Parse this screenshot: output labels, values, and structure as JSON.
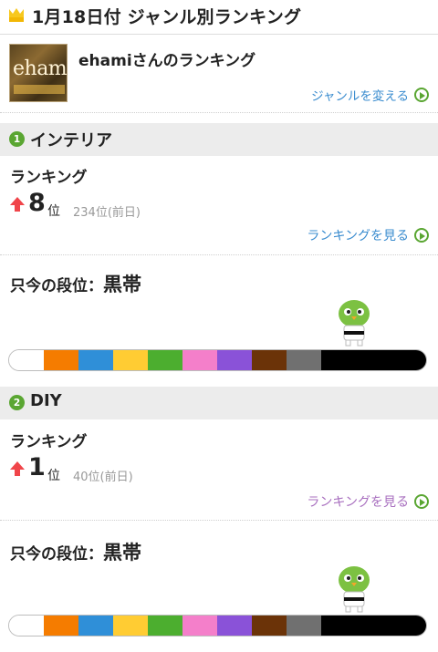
{
  "header": {
    "title": "1月18日付 ジャンル別ランキング"
  },
  "user": {
    "avatar_text": "ehami",
    "name": "ehamiさんのランキング",
    "change_genre": "ジャンルを変える"
  },
  "genres": [
    {
      "number": "1",
      "name": "インテリア",
      "ranking_label": "ランキング",
      "rank": "8",
      "rank_unit": "位",
      "previous": "234位(前日)",
      "see_ranking": "ランキングを見る",
      "see_ranking_color": "#3a8ccf",
      "dan_label": "只今の段位：",
      "dan_value": "黒帯"
    },
    {
      "number": "2",
      "name": "DIY",
      "ranking_label": "ランキング",
      "rank": "1",
      "rank_unit": "位",
      "previous": "40位(前日)",
      "see_ranking": "ランキングを見る",
      "see_ranking_color": "#a86fbf",
      "dan_label": "只今の段位：",
      "dan_value": "黒帯"
    }
  ],
  "belt_colors": [
    "#ffffff",
    "#f57c00",
    "#2f8fd8",
    "#ffcc33",
    "#4cae2f",
    "#f47fca",
    "#8a52d8",
    "#6b3308",
    "#707070",
    "#000000"
  ],
  "icons": {
    "crown": "crown-icon",
    "arrow": "up-arrow-icon",
    "link": "circle-play-icon",
    "mascot": "green-bird-mascot-icon"
  }
}
